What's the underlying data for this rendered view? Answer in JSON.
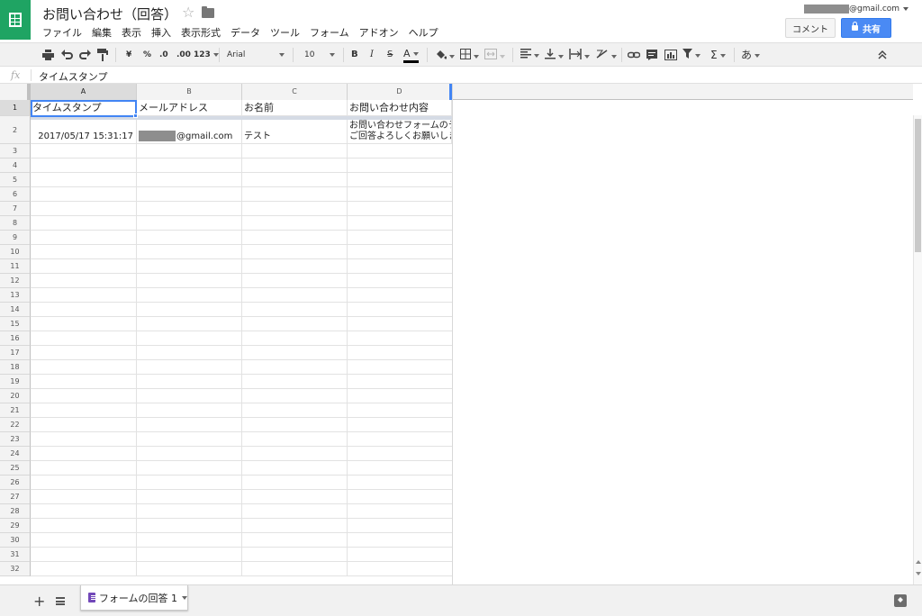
{
  "app": {
    "doc_title": "お問い合わせ（回答）",
    "account_suffix": "@gmail.com",
    "comment_label": "コメント",
    "share_label": "共有"
  },
  "menu": [
    "ファイル",
    "編集",
    "表示",
    "挿入",
    "表示形式",
    "データ",
    "ツール",
    "フォーム",
    "アドオン",
    "ヘルプ"
  ],
  "toolbar": {
    "currency": "¥",
    "percent": "%",
    "dec_decrease": ".0",
    "dec_increase": ".00",
    "more_formats": "123",
    "font": "Arial",
    "font_size": "10",
    "bold": "B",
    "italic": "I",
    "strike": "S",
    "text_color": "A",
    "sigma": "Σ",
    "input_tools": "あ"
  },
  "formula_bar": {
    "fx": "fx",
    "value": "タイムスタンプ"
  },
  "grid": {
    "columns": [
      "A",
      "B",
      "C",
      "D"
    ],
    "row_numbers": [
      "1",
      "2",
      "3",
      "4",
      "5",
      "6",
      "7",
      "8",
      "9",
      "10",
      "11",
      "12",
      "13",
      "14",
      "15",
      "16",
      "17",
      "18",
      "19",
      "20",
      "21",
      "22",
      "23",
      "24",
      "25",
      "26",
      "27",
      "28",
      "29",
      "30",
      "31",
      "32"
    ],
    "headers": [
      "タイムスタンプ",
      "メールアドレス",
      "お名前",
      "お問い合わせ内容"
    ],
    "row2": {
      "timestamp": "2017/05/17 15:31:17",
      "email_suffix": "@gmail.com",
      "name": "テスト",
      "content_line1": "お問い合わせフォームのテ",
      "content_line2": "ご回答よろしくお願いしま"
    }
  },
  "sheets": {
    "active_tab": "フォームの回答 1"
  }
}
